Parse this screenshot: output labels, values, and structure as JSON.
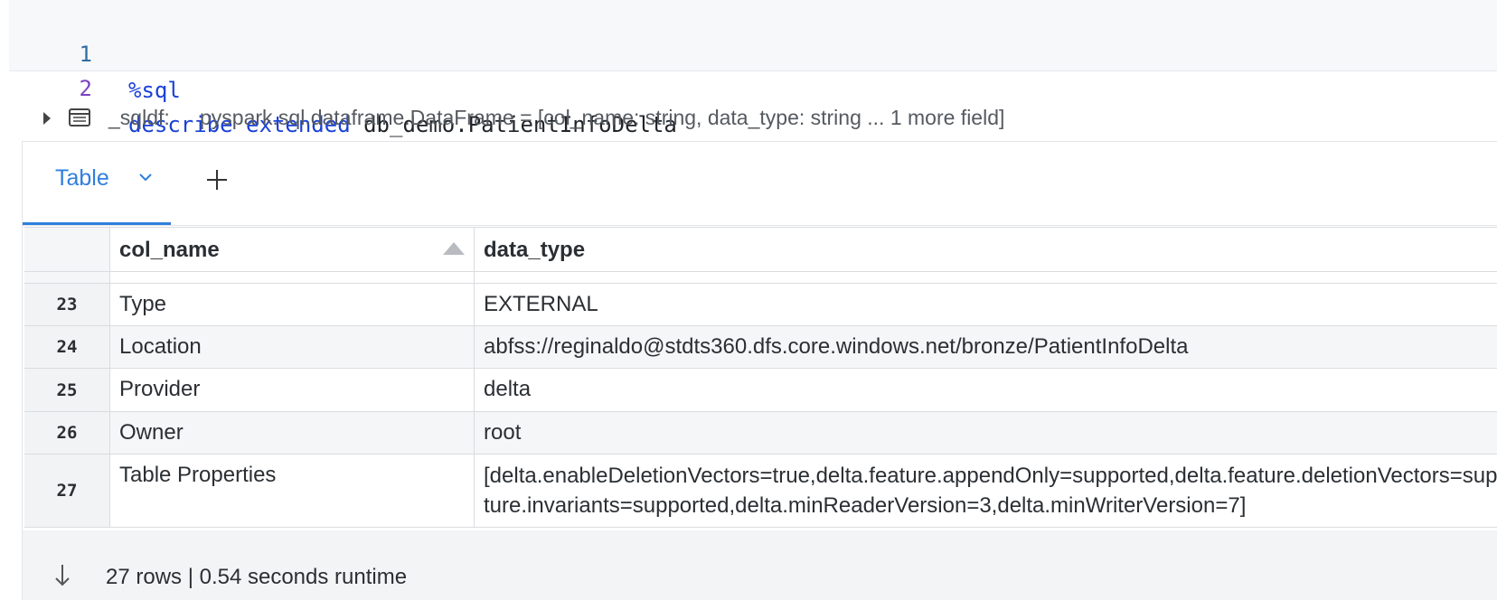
{
  "code": {
    "lines": [
      {
        "num": "1",
        "text": "%sql"
      },
      {
        "num": "2",
        "kw1": "describe",
        "kw2": "extended",
        "rest": "db_demo.PatientInfoDelta"
      }
    ]
  },
  "df_info": {
    "var": "_sqldf:",
    "schema": "pyspark.sql.dataframe.DataFrame = [col_name: string, data_type: string ... 1 more field]"
  },
  "tabs": {
    "active_label": "Table"
  },
  "table": {
    "columns": [
      "col_name",
      "data_type"
    ],
    "rows": [
      {
        "idx": "23",
        "col_name": "Type",
        "data_type": "EXTERNAL"
      },
      {
        "idx": "24",
        "col_name": "Location",
        "data_type": "abfss://reginaldo@stdts360.dfs.core.windows.net/bronze/PatientInfoDelta"
      },
      {
        "idx": "25",
        "col_name": "Provider",
        "data_type": "delta"
      },
      {
        "idx": "26",
        "col_name": "Owner",
        "data_type": "root"
      },
      {
        "idx": "27",
        "col_name": "Table Properties",
        "data_type_line1": "[delta.enableDeletionVectors=true,delta.feature.appendOnly=supported,delta.feature.deletionVectors=supported,delta.fea",
        "data_type_line2": "ture.invariants=supported,delta.minReaderVersion=3,delta.minWriterVersion=7]"
      }
    ]
  },
  "footer": {
    "summary": "27 rows  |  0.54 seconds runtime"
  },
  "colors": {
    "accent": "#2f7fdc",
    "keyword": "#1a41d6"
  }
}
